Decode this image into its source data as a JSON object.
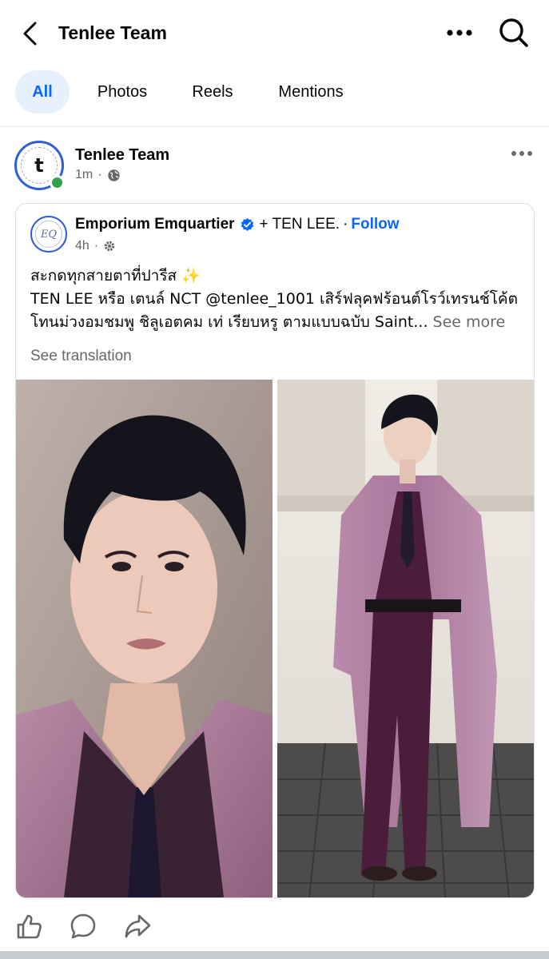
{
  "header": {
    "title": "Tenlee Team"
  },
  "tabs": [
    {
      "label": "All",
      "active": true
    },
    {
      "label": "Photos",
      "active": false
    },
    {
      "label": "Reels",
      "active": false
    },
    {
      "label": "Mentions",
      "active": false
    }
  ],
  "post": {
    "author": "Tenlee Team",
    "avatar_letter": "t",
    "time": "1m",
    "visibility_icon": "globe-icon",
    "shared": {
      "author": "Emporium Emquartier",
      "avatar_text": "EQ",
      "with": "+ TEN LEE.",
      "separator": "·",
      "follow_label": "Follow",
      "time": "4h",
      "settings_icon": "gear-icon",
      "caption_line1": "สะกดทุกสายตาที่ปารีส ✨",
      "caption_line2": "TEN LEE หรือ เตนล์ NCT @tenlee_1001 เสิร์ฟลุคฟร้อนต์โรว์เทรนช์โค้ต",
      "caption_line3": "โทนม่วงอมชมพู ชิลูเอตคม เท่ เรียบหรู ตามแบบฉบับ Saint...",
      "see_more": "See more",
      "see_translation": "See translation"
    }
  },
  "colors": {
    "accent": "#0866ff",
    "tab_active_bg": "#e7f1fd",
    "online": "#31a24c",
    "muted": "#65676b"
  }
}
